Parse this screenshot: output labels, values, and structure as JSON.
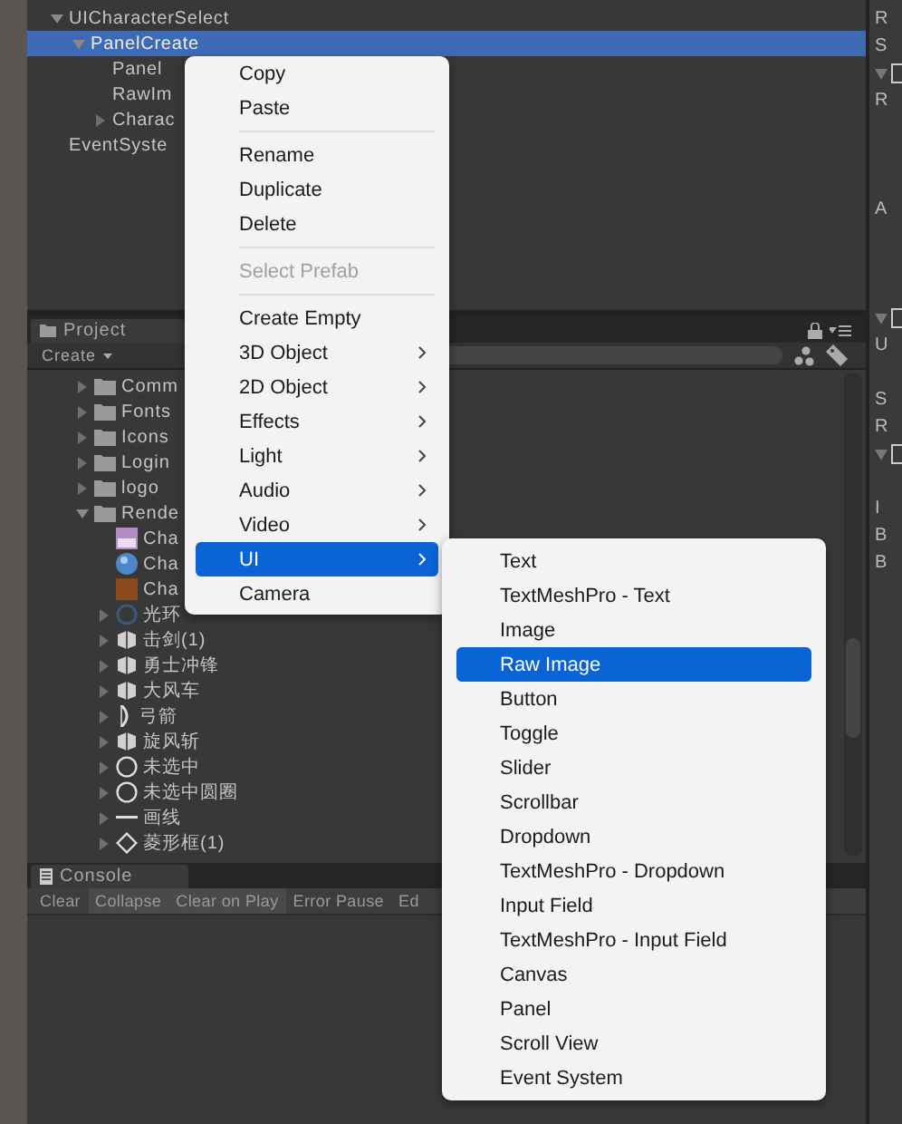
{
  "hierarchy": {
    "items": [
      {
        "label": "UICharacterSelect",
        "expanded": true,
        "selected": false,
        "children": [
          {
            "label": "PanelCreate",
            "expanded": true,
            "selected": true,
            "children": [
              {
                "label": "Panel",
                "selected": false
              },
              {
                "label": "RawIm",
                "selected": false
              },
              {
                "label": "Charac",
                "expanded": false,
                "selected": false
              }
            ]
          }
        ]
      },
      {
        "label": "EventSyste",
        "selected": false
      }
    ]
  },
  "project": {
    "tab": "Project",
    "create_button": "Create",
    "items": [
      {
        "label": "Comm",
        "kind": "folder",
        "expanded": false
      },
      {
        "label": "Fonts",
        "kind": "folder",
        "expanded": false
      },
      {
        "label": "Icons",
        "kind": "folder",
        "expanded": false
      },
      {
        "label": "Login",
        "kind": "folder",
        "expanded": false
      },
      {
        "label": "logo",
        "kind": "folder",
        "expanded": false
      },
      {
        "label": "Rende",
        "kind": "folder",
        "expanded": true,
        "children": [
          {
            "label": "Cha",
            "kind": "image"
          },
          {
            "label": "Cha",
            "kind": "material"
          },
          {
            "label": "Cha",
            "kind": "texture"
          },
          {
            "label": "光环",
            "kind": "ring",
            "expanded": false
          },
          {
            "label": "击剑(1)",
            "kind": "prefab",
            "expanded": false
          },
          {
            "label": "勇士冲锋",
            "kind": "prefab",
            "expanded": false
          },
          {
            "label": "大风车",
            "kind": "prefab",
            "expanded": false
          },
          {
            "label": "弓箭",
            "kind": "bow",
            "expanded": false
          },
          {
            "label": "旋风斩",
            "kind": "prefab",
            "expanded": false
          },
          {
            "label": "未选中",
            "kind": "circle",
            "expanded": false
          },
          {
            "label": "未选中圆圈",
            "kind": "circle",
            "expanded": false
          },
          {
            "label": "画线",
            "kind": "line",
            "expanded": false
          },
          {
            "label": "菱形框(1)",
            "kind": "diamond",
            "expanded": false
          }
        ]
      }
    ]
  },
  "console": {
    "tab": "Console",
    "buttons": [
      {
        "label": "Clear",
        "on": false
      },
      {
        "label": "Collapse",
        "on": true
      },
      {
        "label": "Clear on Play",
        "on": true
      },
      {
        "label": "Error Pause",
        "on": false
      },
      {
        "label": "Ed",
        "on": false
      }
    ]
  },
  "inspector": {
    "rows": [
      {
        "kind": "label",
        "text": "R"
      },
      {
        "kind": "label",
        "text": "S"
      },
      {
        "kind": "header"
      },
      {
        "kind": "label",
        "text": "R"
      },
      {
        "kind": "gap"
      },
      {
        "kind": "gap"
      },
      {
        "kind": "gap"
      },
      {
        "kind": "label",
        "text": "A"
      },
      {
        "kind": "gap"
      },
      {
        "kind": "gap"
      },
      {
        "kind": "gap"
      },
      {
        "kind": "header"
      },
      {
        "kind": "label",
        "text": "U"
      },
      {
        "kind": "gap"
      },
      {
        "kind": "label",
        "text": "S"
      },
      {
        "kind": "label",
        "text": "R"
      },
      {
        "kind": "header"
      },
      {
        "kind": "gap"
      },
      {
        "kind": "label",
        "text": "I"
      },
      {
        "kind": "label",
        "text": "B"
      },
      {
        "kind": "label",
        "text": "B"
      }
    ]
  },
  "context_menu": {
    "items": [
      {
        "kind": "action",
        "label": "Copy",
        "disabled": false,
        "selected": false
      },
      {
        "kind": "action",
        "label": "Paste",
        "disabled": false,
        "selected": false
      },
      {
        "kind": "separator"
      },
      {
        "kind": "action",
        "label": "Rename",
        "disabled": false,
        "selected": false
      },
      {
        "kind": "action",
        "label": "Duplicate",
        "disabled": false,
        "selected": false
      },
      {
        "kind": "action",
        "label": "Delete",
        "disabled": false,
        "selected": false
      },
      {
        "kind": "separator"
      },
      {
        "kind": "action",
        "label": "Select Prefab",
        "disabled": true,
        "selected": false
      },
      {
        "kind": "separator"
      },
      {
        "kind": "action",
        "label": "Create Empty",
        "disabled": false,
        "selected": false
      },
      {
        "kind": "submenu",
        "label": "3D Object",
        "disabled": false,
        "selected": false
      },
      {
        "kind": "submenu",
        "label": "2D Object",
        "disabled": false,
        "selected": false
      },
      {
        "kind": "submenu",
        "label": "Effects",
        "disabled": false,
        "selected": false
      },
      {
        "kind": "submenu",
        "label": "Light",
        "disabled": false,
        "selected": false
      },
      {
        "kind": "submenu",
        "label": "Audio",
        "disabled": false,
        "selected": false
      },
      {
        "kind": "submenu",
        "label": "Video",
        "disabled": false,
        "selected": false
      },
      {
        "kind": "submenu",
        "label": "UI",
        "disabled": false,
        "selected": true
      },
      {
        "kind": "action",
        "label": "Camera",
        "disabled": false,
        "selected": false
      }
    ]
  },
  "submenu": {
    "items": [
      {
        "label": "Text",
        "selected": false
      },
      {
        "label": "TextMeshPro - Text",
        "selected": false
      },
      {
        "label": "Image",
        "selected": false
      },
      {
        "label": "Raw Image",
        "selected": true
      },
      {
        "label": "Button",
        "selected": false
      },
      {
        "label": "Toggle",
        "selected": false
      },
      {
        "label": "Slider",
        "selected": false
      },
      {
        "label": "Scrollbar",
        "selected": false
      },
      {
        "label": "Dropdown",
        "selected": false
      },
      {
        "label": "TextMeshPro - Dropdown",
        "selected": false
      },
      {
        "label": "Input Field",
        "selected": false
      },
      {
        "label": "TextMeshPro - Input Field",
        "selected": false
      },
      {
        "label": "Canvas",
        "selected": false
      },
      {
        "label": "Panel",
        "selected": false
      },
      {
        "label": "Scroll View",
        "selected": false
      },
      {
        "label": "Event System",
        "selected": false
      }
    ]
  }
}
